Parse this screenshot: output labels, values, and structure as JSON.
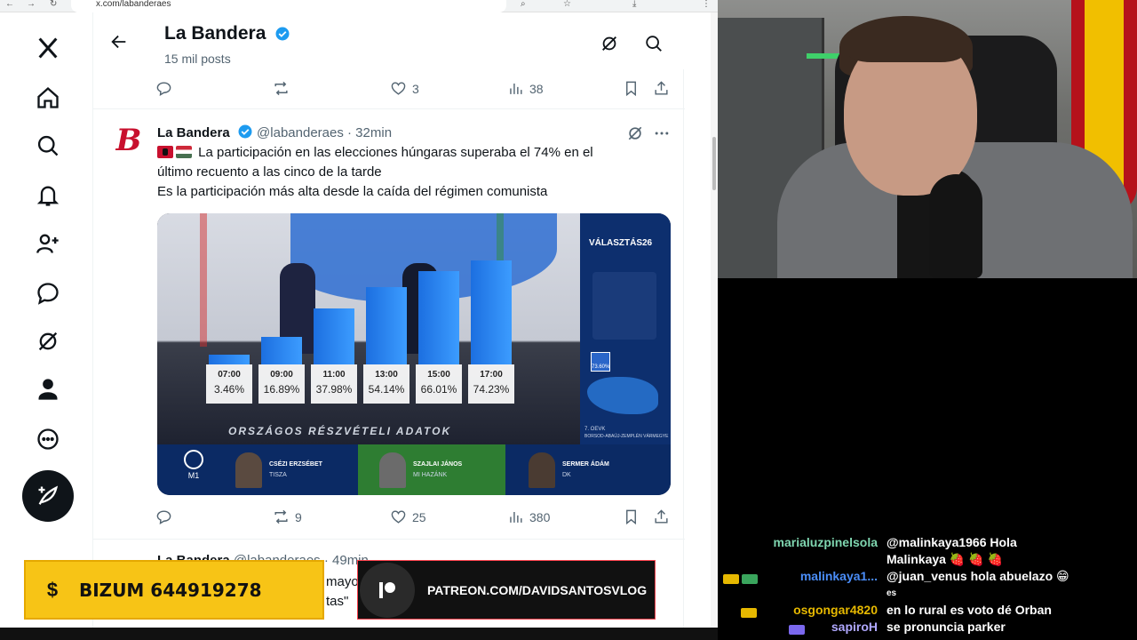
{
  "browser": {
    "url": "x.com/labanderaes"
  },
  "header": {
    "title": "La Bandera",
    "post_count": "15 mil posts"
  },
  "prev_tweet_actions": {
    "likes": "3",
    "views": "38"
  },
  "tweet": {
    "name": "La Bandera",
    "handle": "@labanderaes",
    "time": "· 32min",
    "line1": "La participación en las elecciones húngaras superaba el 74% en el",
    "line2": "último recuento a las cinco de la tarde",
    "line3": "Es la participación más alta desde la caída del régimen comunista",
    "retweets": "9",
    "likes": "25",
    "views": "380"
  },
  "media": {
    "brand": "VÁLASZTÁS26",
    "caption": "ORSZÁGOS RÉSZVÉTELI ADATOK",
    "region_pct": "73.60%",
    "region_code": "7. OEVK",
    "region_name": "BORSOD-ABAÚJ-ZEMPLÉN VÁRMEGYE",
    "channel": "M1",
    "bars": [
      {
        "time": "07:00",
        "pct": "3.46%",
        "value": 3.46
      },
      {
        "time": "09:00",
        "pct": "16.89%",
        "value": 16.89
      },
      {
        "time": "11:00",
        "pct": "37.98%",
        "value": 37.98
      },
      {
        "time": "13:00",
        "pct": "54.14%",
        "value": 54.14
      },
      {
        "time": "15:00",
        "pct": "66.01%",
        "value": 66.01
      },
      {
        "time": "17:00",
        "pct": "74.23%",
        "value": 74.23
      }
    ],
    "candidates": [
      {
        "name": "CSÉZI ERZSÉBET",
        "party": "TISZA"
      },
      {
        "name": "SZAJLAI JÁNOS",
        "party": "MI HAZÁNK"
      },
      {
        "name": "SERMER ÁDÁM",
        "party": "DK"
      }
    ]
  },
  "next_tweet": {
    "name": "La Bandera",
    "handle": "@labanderaes",
    "time": "· 49min",
    "peek1": "mayo",
    "peek2": "tas\""
  },
  "overlays": {
    "bizum_symbol": "$",
    "bizum": "BIZUM 644919278",
    "patreon": "PATREON.COM/DAVIDSANTOSVLOG"
  },
  "chat": [
    {
      "user": "marialuzpinelsola",
      "color": "#7fd6b0",
      "line1": "@malinkaya1966 Hola",
      "line2": "Malinkaya 🍓 🍓 🍓"
    },
    {
      "user": "malinkaya1...",
      "color": "#4a8df8",
      "line1": "@juan_venus hola abuelazo 😁",
      "line2": "es"
    },
    {
      "user": "osgongar4820",
      "color": "#e6b800",
      "line1": "en lo rural es voto dé Orban",
      "line2": ""
    },
    {
      "user": "sapiroH",
      "color": "#b0a8ff",
      "line1": "se pronuncia parker",
      "line2": ""
    }
  ],
  "colors": {
    "x_text": "#0f1419",
    "x_secondary": "#536471",
    "verified_blue": "#1d9bf0",
    "bizum_yellow": "#f7c416",
    "patreon_red": "#ff424d"
  }
}
